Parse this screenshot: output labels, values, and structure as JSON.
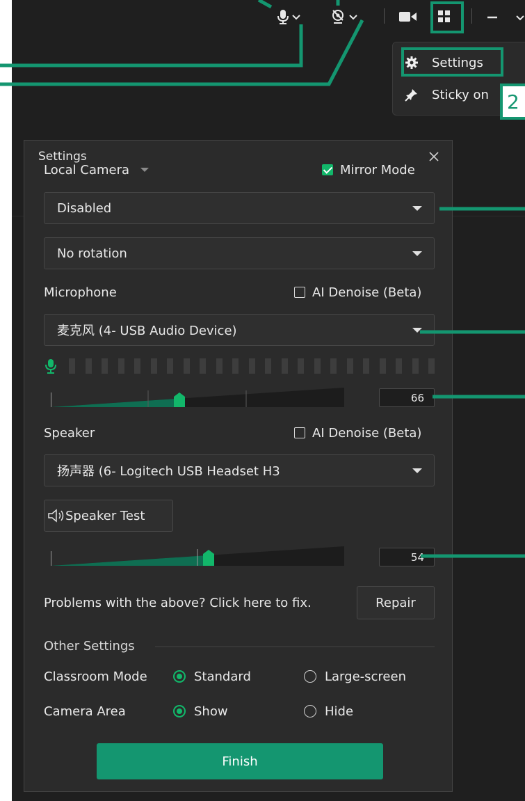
{
  "colors": {
    "accent": "#149670",
    "success": "#12b76a",
    "panel": "#2b2b2b",
    "background": "#1f1f1f"
  },
  "topbar": {
    "icons": [
      "microphone-icon",
      "chevron-down-icon",
      "camera-off-icon",
      "chevron-down-icon",
      "video-camera-icon",
      "grid-icon",
      "minimize-icon",
      "chevron-down-icon"
    ]
  },
  "menu": {
    "items": [
      {
        "label": "Settings",
        "icon": "gear-icon"
      },
      {
        "label": "Sticky on",
        "icon": "pin-icon"
      }
    ],
    "step_badge": "2"
  },
  "dialog": {
    "title": "Settings",
    "camera": {
      "label": "Local Camera",
      "mirror_label": "Mirror Mode",
      "mirror_checked": true,
      "device_value": "Disabled",
      "rotation_value": "No rotation"
    },
    "microphone": {
      "label": "Microphone",
      "denoise_label": "AI Denoise (Beta)",
      "denoise_checked": false,
      "device_value": "麦克风 (4- USB Audio Device)",
      "volume": "66",
      "level_bars": 23
    },
    "speaker": {
      "label": "Speaker",
      "denoise_label": "AI Denoise (Beta)",
      "denoise_checked": false,
      "device_value": "扬声器 (6- Logitech USB Headset H3",
      "test_label": "Speaker Test",
      "volume": "54"
    },
    "repair": {
      "text": "Problems with the above? Click here to fix.",
      "button_label": "Repair"
    },
    "other": {
      "section_label": "Other Settings",
      "classroom_label": "Classroom Mode",
      "classroom_options": [
        "Standard",
        "Large-screen"
      ],
      "classroom_selected": "Standard",
      "camera_area_label": "Camera Area",
      "camera_area_options": [
        "Show",
        "Hide"
      ],
      "camera_area_selected": "Show"
    },
    "finish_label": "Finish"
  }
}
